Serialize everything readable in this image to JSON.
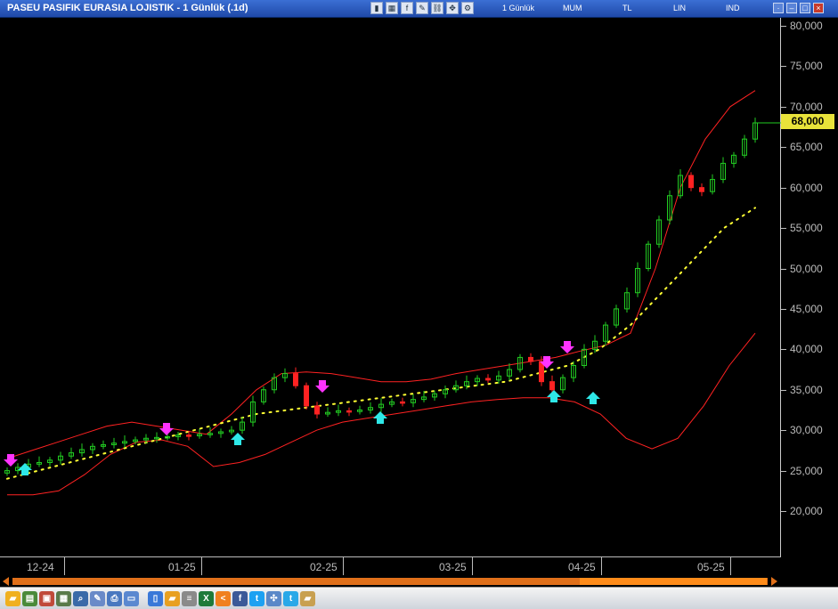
{
  "window": {
    "title": "PASEU PASIFIK EURASIA LOJISTIK - 1 Günlük (.1d)",
    "toolbar_texts": [
      "1 Günlük",
      "MUM",
      "TL",
      "LIN",
      "IND"
    ],
    "window_buttons": [
      "·",
      "–",
      "□",
      "×"
    ]
  },
  "chart": {
    "current_price": "68,000",
    "y_axis_labels": [
      "80,000",
      "75,000",
      "70,000",
      "65,000",
      "60,000",
      "55,000",
      "50,000",
      "45,000",
      "40,000",
      "35,000",
      "30,000",
      "25,000",
      "20,000"
    ],
    "x_axis_labels": [
      "12-24",
      "01-25",
      "02-25",
      "03-25",
      "04-25",
      "05-25"
    ],
    "colors": {
      "up": "#22cc22",
      "down": "#ff2222",
      "band": "#ff2222",
      "sar": "#ffff33",
      "buy_arrow": "#2ee8e8",
      "sell_arrow": "#ff33ff",
      "price_tag": "#e8e23a"
    }
  },
  "chart_data": {
    "type": "candlestick",
    "x_range": [
      "12-24",
      "05-25"
    ],
    "ylim": [
      17000,
      82000
    ],
    "close_series": [
      25000,
      25400,
      25800,
      26000,
      26300,
      26800,
      27200,
      27600,
      28000,
      28200,
      28400,
      28600,
      28800,
      29000,
      29100,
      29200,
      29400,
      29300,
      29500,
      29600,
      29800,
      30000,
      31000,
      33500,
      35000,
      36500,
      37000,
      35500,
      33000,
      32000,
      32200,
      32400,
      32300,
      32500,
      32800,
      33200,
      33500,
      33400,
      33800,
      34100,
      34500,
      35000,
      35500,
      36000,
      36400,
      36200,
      36700,
      37500,
      39000,
      38500,
      36000,
      35000,
      36500,
      38000,
      40000,
      41000,
      43000,
      45000,
      47000,
      50000,
      53000,
      56000,
      59000,
      61500,
      60000,
      59500,
      61000,
      63000,
      64000,
      66000,
      68000
    ],
    "upper_band_y": [
      26500,
      27500,
      28500,
      29500,
      30500,
      31000,
      30500,
      30000,
      29500,
      32000,
      35000,
      37000,
      37200,
      37000,
      36500,
      36000,
      36000,
      36300,
      37000,
      37500,
      38000,
      38500,
      39000,
      39800,
      40500,
      42000,
      50000,
      60000,
      66000,
      70000,
      72000
    ],
    "lower_band_y": [
      22000,
      22000,
      22500,
      24500,
      27000,
      28500,
      28800,
      28000,
      25500,
      26000,
      27000,
      28500,
      30000,
      31000,
      31500,
      32000,
      32500,
      33000,
      33500,
      33800,
      34000,
      34000,
      33500,
      32000,
      29000,
      27700,
      29000,
      33000,
      38000,
      42000
    ],
    "sar_y": [
      24000,
      25000,
      26000,
      27000,
      28000,
      29000,
      30000,
      31000,
      32000,
      32500,
      33000,
      33500,
      34000,
      34500,
      35000,
      35500,
      36000,
      37000,
      38000,
      40000,
      43000,
      47000,
      51000,
      55000,
      57500
    ],
    "buy_signals_x": [
      "12-24",
      "01-25",
      "02-25",
      "03-25",
      "04-25",
      "04-25"
    ],
    "sell_signals_x": [
      "12-24",
      "01-25",
      "02-25",
      "04-25",
      "04-25"
    ]
  },
  "bottom_toolbar": {
    "icons": [
      "folder-icon",
      "chart-icon",
      "save-icon",
      "grid-icon",
      "zoom-icon",
      "draw-icon",
      "print-icon",
      "print-preview-icon",
      "database-icon",
      "open-icon",
      "list-icon",
      "excel-icon",
      "share-icon",
      "facebook-icon",
      "twitter-icon",
      "link-icon",
      "t-icon",
      "folder-settings-icon"
    ]
  }
}
